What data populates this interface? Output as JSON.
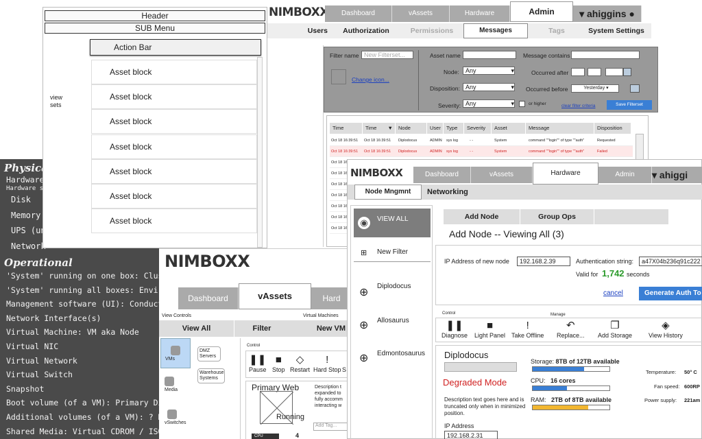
{
  "wireframe": {
    "header": "Header",
    "sub_menu": "SUB Menu",
    "action_bar": "Action Bar",
    "view_sets": "view\nsets",
    "asset_blocks": [
      "Asset block",
      "Asset block",
      "Asset block",
      "Asset block",
      "Asset block",
      "Asset block",
      "Asset block"
    ]
  },
  "chalkboard": {
    "physical_title": "Physical",
    "hardware": "Hardware",
    "hardware_sub": "Hardware sub",
    "items": [
      "Disk",
      "Memory",
      "UPS (unit",
      "Network"
    ],
    "operational_title": "Operational",
    "op_lines": [
      "'System' running on one box: Cluster",
      "'System' running all boxes: Environme",
      "Management software (UI): Conducto",
      "Network Interface(s)",
      "Virtual Machine: VM aka Node",
      "Virtual NIC",
      "Virtual Network",
      "Virtual Switch",
      "Snapshot",
      "Boot volume (of a VM): Primary Disk",
      "Additional volumes (of a VM): ? Disks",
      "Shared Media: Virtual CDROM / ISO"
    ]
  },
  "admin": {
    "logo": "NIMBOXX",
    "tabs": [
      "Dashboard",
      "vAssets",
      "Hardware",
      "Admin"
    ],
    "user": "ahiggins",
    "subtabs": [
      "Users",
      "Authorization",
      "Permissions",
      "Messages",
      "Tags",
      "System Settings"
    ],
    "filter": {
      "filter_name_label": "Filter name",
      "filter_name_placeholder": "New Filterset...",
      "change_icon": "Change icon...",
      "asset_name_label": "Asset name",
      "node_label": "Node:",
      "node_value": "Any",
      "disposition_label": "Disposition:",
      "disposition_value": "Any",
      "severity_label": "Severity:",
      "severity_value": "Any",
      "or_higher": "or higher",
      "message_contains_label": "Message contains",
      "occurred_after_label": "Occurred after",
      "occurred_before_label": "Occurred before",
      "occurred_before_value": "Yesterday",
      "clear_filter": "clear filter criteria",
      "save_filterset": "Save Filterset"
    },
    "table": {
      "headers": [
        "Time",
        "Time",
        "Node",
        "User",
        "Type",
        "Severity",
        "Asset",
        "Message",
        "Disposition"
      ],
      "rows": [
        [
          "Oct 18 16:39:51",
          "Oct 18 16:39:51",
          "Diplodocus",
          "ADMIN",
          "sys log",
          "- -",
          "System",
          "command \"\"login\"\" of type \"\"auth\"",
          "Requested"
        ],
        [
          "Oct 18 16:39:51",
          "Oct 18 16:39:51",
          "Diplodocus",
          "ADMIN",
          "sys log",
          "- -",
          "System",
          "command \"\"login\"\" of type \"\"auth\"",
          "Failed"
        ],
        [
          "Oct 18 16:39:51",
          "",
          "",
          "",
          "",
          "",
          "",
          "",
          ""
        ],
        [
          "Oct 18 16:39:51",
          "",
          "",
          "",
          "",
          "",
          "",
          "",
          ""
        ],
        [
          "Oct 18 16:39:51",
          "",
          "",
          "",
          "",
          "",
          "",
          "",
          ""
        ],
        [
          "Oct 18 16:39:51",
          "",
          "",
          "",
          "",
          "",
          "",
          "",
          ""
        ],
        [
          "Oct 18 16:39:51",
          "",
          "",
          "",
          "",
          "",
          "",
          "",
          ""
        ],
        [
          "Oct 18 16:39:51",
          "",
          "",
          "",
          "",
          "",
          "",
          "",
          ""
        ],
        [
          "Oct 18 16:39:51",
          "",
          "",
          "",
          "",
          "",
          "",
          "",
          ""
        ]
      ]
    }
  },
  "vassets": {
    "logo": "NIMBOXX",
    "tabs": [
      "Dashboard",
      "vAssets",
      "Hard"
    ],
    "view_controls": "View Controls",
    "virtual_machines": "Virtual Machines",
    "view_all": "View All",
    "filter": "Filter",
    "new_vm": "New VM",
    "side": [
      "VMs",
      "Media",
      "vSwitches"
    ],
    "groups": [
      "DMZ Servers",
      "Warehouse Systems"
    ],
    "control": "Control",
    "controls": [
      "Pause",
      "Stop",
      "Restart",
      "Hard Stop",
      "S"
    ],
    "vm_name": "Primary Web",
    "vm_status": "Running",
    "vm_desc": "Description t expanded to fully accomm interacting w",
    "add_tag": "Add Tag...",
    "cpu_label": "CPU",
    "cpu_count": "4"
  },
  "hardware": {
    "logo": "NIMBOXX",
    "tabs": [
      "Dashboard",
      "vAssets",
      "Hardware",
      "Admin"
    ],
    "user": "ahiggi",
    "subtabs": [
      "Node Mngmnt",
      "Networking"
    ],
    "sidebar": [
      "VIEW ALL",
      "New Filter",
      "Diplodocus",
      "Allosaurus",
      "Edmontosaurus"
    ],
    "actions": [
      "Add Node",
      "Group Ops"
    ],
    "title": "Add Node -- Viewing All (3)",
    "ip_label": "IP Address of new node",
    "ip_value": "192.168.2.39",
    "auth_label": "Authentication string:",
    "auth_value": "a47X04b236q91c222",
    "valid_for": "Valid for",
    "valid_seconds": "1,742",
    "seconds": "seconds",
    "cancel": "cancel",
    "generate": "Generate Auth To",
    "control_label": "Control",
    "manage_label": "Manage",
    "controls": [
      "Diagnose",
      "Light Panel",
      "Take Offline",
      "Replace...",
      "Add Storage",
      "View History"
    ],
    "node_name": "Diplodocus",
    "node_state": "Degraded Mode",
    "node_desc": "Description text goes here and is truncated only when in minimized position.",
    "ip_address_label": "IP Address",
    "ip_address_value": "192.168.2.31",
    "storage_label": "Storage:",
    "storage_value": "8TB of 12TB available",
    "storage_fraction": 0.67,
    "cpu_label": "CPU:",
    "cpu_value": "16 cores",
    "cpu_fraction": 0.45,
    "ram_label": "RAM:",
    "ram_value": "2TB of 8TB available",
    "ram_fraction": 0.72,
    "temperature_label": "Temperature:",
    "temperature_value": "50° C",
    "fan_label": "Fan speed:",
    "fan_value": "600RP",
    "power_label": "Power supply:",
    "power_value": "221am",
    "colors": {
      "accent": "#3a7fd5",
      "green": "#2a9a2a",
      "red": "#d02020",
      "ram_fill": "#f2b630"
    }
  }
}
